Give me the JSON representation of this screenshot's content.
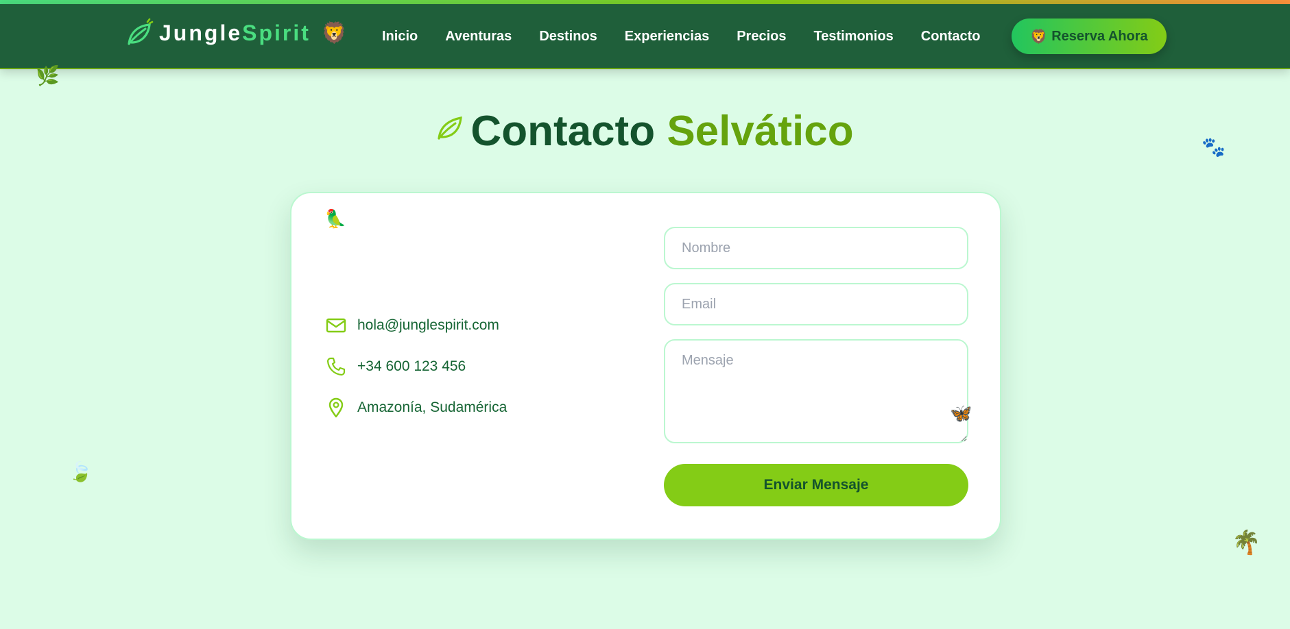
{
  "nav": {
    "brand_part1": "Jungle",
    "brand_part2": "Spirit",
    "brand_emoji": "🦁",
    "links": [
      "Inicio",
      "Aventuras",
      "Destinos",
      "Experiencias",
      "Precios",
      "Testimonios",
      "Contacto"
    ],
    "cta_emoji": "🦁",
    "cta_label": "Reserva Ahora"
  },
  "heading": {
    "part1": "Contacto",
    "part2": "Selvático"
  },
  "decorations": {
    "top_left": "🌿",
    "bottom_left": "🍃",
    "top_right": "🐾",
    "bottom_right": "🌴",
    "card_parrot": "🦜",
    "textarea_butterfly": "🦋"
  },
  "contact": {
    "email": "hola@junglespirit.com",
    "phone": "+34 600 123 456",
    "location": "Amazonía, Sudamérica"
  },
  "form": {
    "name_placeholder": "Nombre",
    "email_placeholder": "Email",
    "message_placeholder": "Mensaje",
    "submit_label": "Enviar Mensaje"
  },
  "icons": {
    "logo": "leaf-icon",
    "email": "mail-icon",
    "phone": "phone-icon",
    "location": "map-pin-icon"
  },
  "colors": {
    "nav_bg": "#1f5f3a",
    "page_bg": "#dcfce7",
    "accent_green": "#84cc16",
    "brand_green": "#4ade80",
    "heading_dark": "#14532d",
    "heading_accent": "#65a30d"
  }
}
